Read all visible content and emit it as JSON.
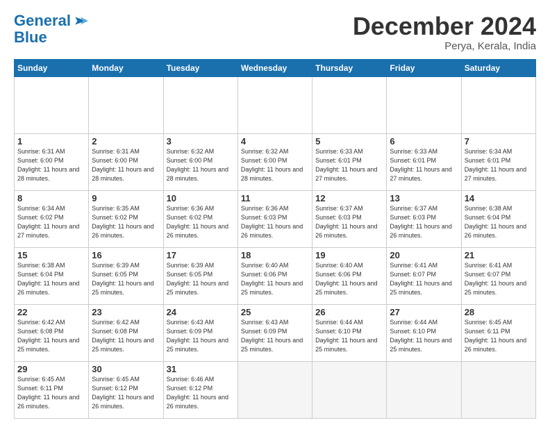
{
  "header": {
    "logo_line1": "General",
    "logo_line2": "Blue",
    "title": "December 2024",
    "subtitle": "Perya, Kerala, India"
  },
  "calendar": {
    "days_of_week": [
      "Sunday",
      "Monday",
      "Tuesday",
      "Wednesday",
      "Thursday",
      "Friday",
      "Saturday"
    ],
    "weeks": [
      [
        {
          "day": "",
          "empty": true
        },
        {
          "day": "",
          "empty": true
        },
        {
          "day": "",
          "empty": true
        },
        {
          "day": "",
          "empty": true
        },
        {
          "day": "",
          "empty": true
        },
        {
          "day": "",
          "empty": true
        },
        {
          "day": "",
          "empty": true
        }
      ],
      [
        {
          "day": "1",
          "sunrise": "6:31 AM",
          "sunset": "6:00 PM",
          "daylight": "11 hours and 28 minutes."
        },
        {
          "day": "2",
          "sunrise": "6:31 AM",
          "sunset": "6:00 PM",
          "daylight": "11 hours and 28 minutes."
        },
        {
          "day": "3",
          "sunrise": "6:32 AM",
          "sunset": "6:00 PM",
          "daylight": "11 hours and 28 minutes."
        },
        {
          "day": "4",
          "sunrise": "6:32 AM",
          "sunset": "6:00 PM",
          "daylight": "11 hours and 28 minutes."
        },
        {
          "day": "5",
          "sunrise": "6:33 AM",
          "sunset": "6:01 PM",
          "daylight": "11 hours and 27 minutes."
        },
        {
          "day": "6",
          "sunrise": "6:33 AM",
          "sunset": "6:01 PM",
          "daylight": "11 hours and 27 minutes."
        },
        {
          "day": "7",
          "sunrise": "6:34 AM",
          "sunset": "6:01 PM",
          "daylight": "11 hours and 27 minutes."
        }
      ],
      [
        {
          "day": "8",
          "sunrise": "6:34 AM",
          "sunset": "6:02 PM",
          "daylight": "11 hours and 27 minutes."
        },
        {
          "day": "9",
          "sunrise": "6:35 AM",
          "sunset": "6:02 PM",
          "daylight": "11 hours and 26 minutes."
        },
        {
          "day": "10",
          "sunrise": "6:36 AM",
          "sunset": "6:02 PM",
          "daylight": "11 hours and 26 minutes."
        },
        {
          "day": "11",
          "sunrise": "6:36 AM",
          "sunset": "6:03 PM",
          "daylight": "11 hours and 26 minutes."
        },
        {
          "day": "12",
          "sunrise": "6:37 AM",
          "sunset": "6:03 PM",
          "daylight": "11 hours and 26 minutes."
        },
        {
          "day": "13",
          "sunrise": "6:37 AM",
          "sunset": "6:03 PM",
          "daylight": "11 hours and 26 minutes."
        },
        {
          "day": "14",
          "sunrise": "6:38 AM",
          "sunset": "6:04 PM",
          "daylight": "11 hours and 26 minutes."
        }
      ],
      [
        {
          "day": "15",
          "sunrise": "6:38 AM",
          "sunset": "6:04 PM",
          "daylight": "11 hours and 26 minutes."
        },
        {
          "day": "16",
          "sunrise": "6:39 AM",
          "sunset": "6:05 PM",
          "daylight": "11 hours and 25 minutes."
        },
        {
          "day": "17",
          "sunrise": "6:39 AM",
          "sunset": "6:05 PM",
          "daylight": "11 hours and 25 minutes."
        },
        {
          "day": "18",
          "sunrise": "6:40 AM",
          "sunset": "6:06 PM",
          "daylight": "11 hours and 25 minutes."
        },
        {
          "day": "19",
          "sunrise": "6:40 AM",
          "sunset": "6:06 PM",
          "daylight": "11 hours and 25 minutes."
        },
        {
          "day": "20",
          "sunrise": "6:41 AM",
          "sunset": "6:07 PM",
          "daylight": "11 hours and 25 minutes."
        },
        {
          "day": "21",
          "sunrise": "6:41 AM",
          "sunset": "6:07 PM",
          "daylight": "11 hours and 25 minutes."
        }
      ],
      [
        {
          "day": "22",
          "sunrise": "6:42 AM",
          "sunset": "6:08 PM",
          "daylight": "11 hours and 25 minutes."
        },
        {
          "day": "23",
          "sunrise": "6:42 AM",
          "sunset": "6:08 PM",
          "daylight": "11 hours and 25 minutes."
        },
        {
          "day": "24",
          "sunrise": "6:43 AM",
          "sunset": "6:09 PM",
          "daylight": "11 hours and 25 minutes."
        },
        {
          "day": "25",
          "sunrise": "6:43 AM",
          "sunset": "6:09 PM",
          "daylight": "11 hours and 25 minutes."
        },
        {
          "day": "26",
          "sunrise": "6:44 AM",
          "sunset": "6:10 PM",
          "daylight": "11 hours and 25 minutes."
        },
        {
          "day": "27",
          "sunrise": "6:44 AM",
          "sunset": "6:10 PM",
          "daylight": "11 hours and 25 minutes."
        },
        {
          "day": "28",
          "sunrise": "6:45 AM",
          "sunset": "6:11 PM",
          "daylight": "11 hours and 26 minutes."
        }
      ],
      [
        {
          "day": "29",
          "sunrise": "6:45 AM",
          "sunset": "6:11 PM",
          "daylight": "11 hours and 26 minutes."
        },
        {
          "day": "30",
          "sunrise": "6:45 AM",
          "sunset": "6:12 PM",
          "daylight": "11 hours and 26 minutes."
        },
        {
          "day": "31",
          "sunrise": "6:46 AM",
          "sunset": "6:12 PM",
          "daylight": "11 hours and 26 minutes."
        },
        {
          "day": "",
          "empty": true
        },
        {
          "day": "",
          "empty": true
        },
        {
          "day": "",
          "empty": true
        },
        {
          "day": "",
          "empty": true
        }
      ]
    ]
  }
}
